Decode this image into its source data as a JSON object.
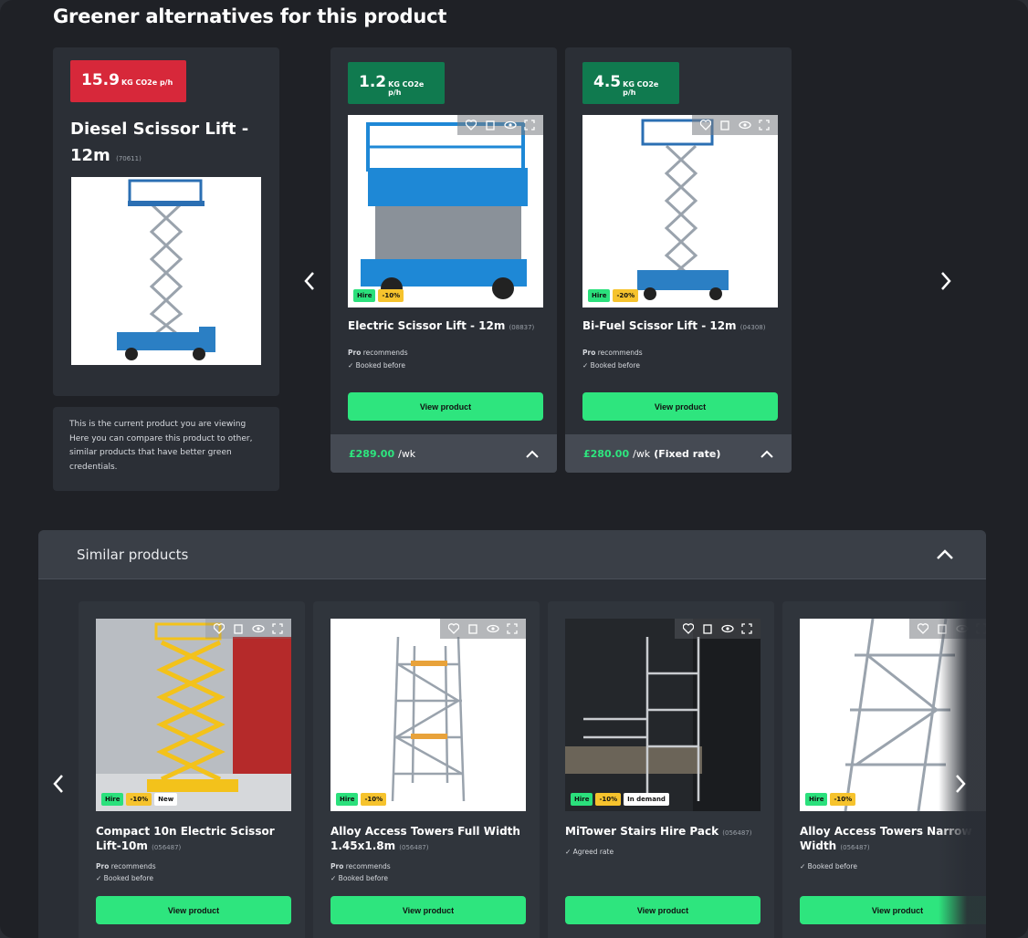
{
  "title": "Greener alternatives for this product",
  "current": {
    "co2_value": "15.9",
    "co2_unit": "KG CO2e p/h",
    "name": "Diesel Scissor Lift - 12m",
    "code": "(70611)",
    "info": "This is the current product you are viewing Here you can compare this product to other, similar products that have better green credentials."
  },
  "alternatives": [
    {
      "co2_value": "1.2",
      "co2_unit": "KG CO2e p/h",
      "name": "Electric Scissor Lift - 12m",
      "code": "(08837)",
      "tags": [
        "Hire",
        "-10%"
      ],
      "meta": [
        {
          "bold": "Pro",
          "text": " recommends"
        },
        {
          "bold": "",
          "text": "✓ Booked before"
        }
      ],
      "button": "View product",
      "price": "£289.00",
      "price_suffix": "/wk",
      "price_note": ""
    },
    {
      "co2_value": "4.5",
      "co2_unit": "KG CO2e p/h",
      "name": "Bi-Fuel Scissor Lift - 12m",
      "code": "(04308)",
      "tags": [
        "Hire",
        "-20%"
      ],
      "meta": [
        {
          "bold": "Pro",
          "text": " recommends"
        },
        {
          "bold": "",
          "text": "✓ Booked before"
        }
      ],
      "button": "View product",
      "price": "£280.00",
      "price_suffix": "/wk",
      "price_note": "(Fixed rate)"
    }
  ],
  "similar": {
    "header": "Similar products",
    "items": [
      {
        "name": "Compact 10n Electric Scissor Lift-10m",
        "code": "(056487)",
        "tags": [
          "Hire",
          "-10%",
          "New"
        ],
        "meta": [
          {
            "bold": "Pro",
            "text": " recommends"
          },
          {
            "bold": "",
            "text": "✓ Booked before"
          }
        ],
        "button": "View product"
      },
      {
        "name": "Alloy Access Towers Full Width 1.45x1.8m",
        "code": "(056487)",
        "tags": [
          "Hire",
          "-10%"
        ],
        "meta": [
          {
            "bold": "Pro",
            "text": " recommends"
          },
          {
            "bold": "",
            "text": "✓ Booked before"
          }
        ],
        "button": "View product"
      },
      {
        "name": "MiTower Stairs Hire Pack",
        "code": "(056487)",
        "tags": [
          "Hire",
          "-10%",
          "In demand"
        ],
        "meta": [
          {
            "bold": "",
            "text": "✓ Agreed rate"
          }
        ],
        "button": "View product"
      },
      {
        "name": "Alloy Access Towers Narrow Width",
        "code": "(056487)",
        "tags": [
          "Hire",
          "-10%"
        ],
        "meta": [
          {
            "bold": "",
            "text": "✓ Booked before"
          }
        ],
        "button": "View product"
      }
    ]
  },
  "colors": {
    "accent": "#2ee57e",
    "badge_red": "#d7283a",
    "badge_green": "#107a4f",
    "discount": "#f6c32d"
  },
  "icons": [
    "heart-plus-icon",
    "clipboard-icon",
    "eye-icon",
    "expand-icon",
    "chevron-left-icon",
    "chevron-right-icon",
    "chevron-up-icon"
  ]
}
